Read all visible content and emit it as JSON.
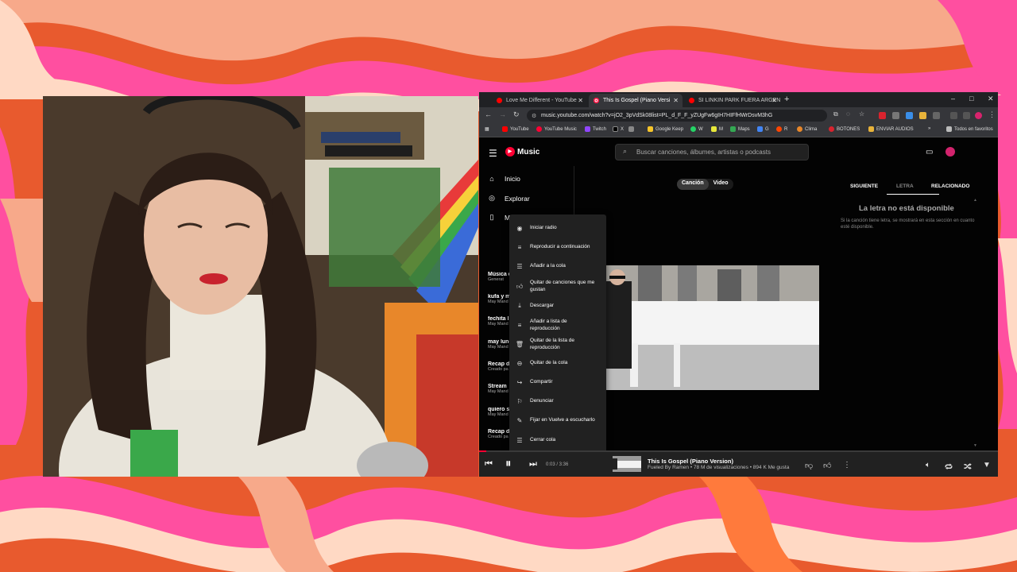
{
  "browser": {
    "tabs": [
      {
        "title": "Love Me Different - YouTube",
        "active": false
      },
      {
        "title": "This Is Gospel (Piano Versi",
        "active": true
      },
      {
        "title": "SI LINKIN PARK FUERA ARGEN",
        "active": false
      }
    ],
    "url": "music.youtube.com/watch?v=jO2_3pVdSk08list=PL_d_F_F_yZUgFw6gIH7HIFfHWrDsvM3hG",
    "bookmarks": [
      "YouTube",
      "YouTube Music",
      "Twitch",
      "X",
      "",
      "Google Keep",
      "W",
      "M",
      "Maps",
      "G",
      "R",
      "Clima",
      "BOTONES",
      "ENVIAR AUDIOS"
    ],
    "bookmarks_folder": "Todos en favoritos",
    "window_controls": [
      "–",
      "□",
      "✕"
    ]
  },
  "ytm": {
    "logo": "Music",
    "search_placeholder": "Buscar canciones, álbumes, artistas o podcasts",
    "nav": [
      {
        "label": "Inicio",
        "icon": "home-icon"
      },
      {
        "label": "Explorar",
        "icon": "explore-icon"
      },
      {
        "label": "M",
        "icon": "library-icon"
      }
    ],
    "playlists": [
      {
        "title": "Música c",
        "subtitle": "Generat"
      },
      {
        "title": "kufa y m",
        "subtitle": "May Mand"
      },
      {
        "title": "fechita l",
        "subtitle": "May Mand"
      },
      {
        "title": "may lune",
        "subtitle": "May Mand"
      },
      {
        "title": "Recap de",
        "subtitle": "Creado pa"
      },
      {
        "title": "Stream",
        "subtitle": "May Mand"
      },
      {
        "title": "quiero se",
        "subtitle": "May Mand"
      },
      {
        "title": "Recap de",
        "subtitle": "Creado pa"
      }
    ],
    "toggle": {
      "song": "Canción",
      "video": "Video"
    },
    "right_tabs": [
      "SIGUIENTE",
      "LETRA",
      "RELACIONADO"
    ],
    "lyrics_title": "La letra no está disponible",
    "lyrics_sub": "Si la canción tiene letra, se mostrará en esta sección en cuanto esté disponible.",
    "menu": [
      {
        "label": "Iniciar radio",
        "icon": "radio-icon"
      },
      {
        "label": "Reproducir a continuación",
        "icon": "play-next-icon"
      },
      {
        "label": "Añadir a la cola",
        "icon": "queue-add-icon"
      },
      {
        "label": "Quitar de canciones que me gustan",
        "icon": "thumb-up-icon"
      },
      {
        "label": "Descargar",
        "icon": "download-icon"
      },
      {
        "label": "Añadir a lista de reproducción",
        "icon": "playlist-add-icon"
      },
      {
        "label": "Quitar de la lista de reproducción",
        "icon": "trash-icon"
      },
      {
        "label": "Quitar de la cola",
        "icon": "remove-circle-icon"
      },
      {
        "label": "Compartir",
        "icon": "share-icon"
      },
      {
        "label": "Denunciar",
        "icon": "flag-icon"
      },
      {
        "label": "Fijar en Vuelve a escucharlo",
        "icon": "pin-icon"
      },
      {
        "label": "Cerrar cola",
        "icon": "close-queue-icon"
      }
    ],
    "player": {
      "time": "0:03 / 3:36",
      "progress": 0.014,
      "title": "This Is Gospel (Piano Version)",
      "subtitle": "Fueled By Ramen • 78 M de visualizaciones • 894 K Me gusta"
    }
  },
  "colors": {
    "accent": "#ff0033",
    "ytm_bg": "#030303",
    "player_bg": "#212121"
  }
}
